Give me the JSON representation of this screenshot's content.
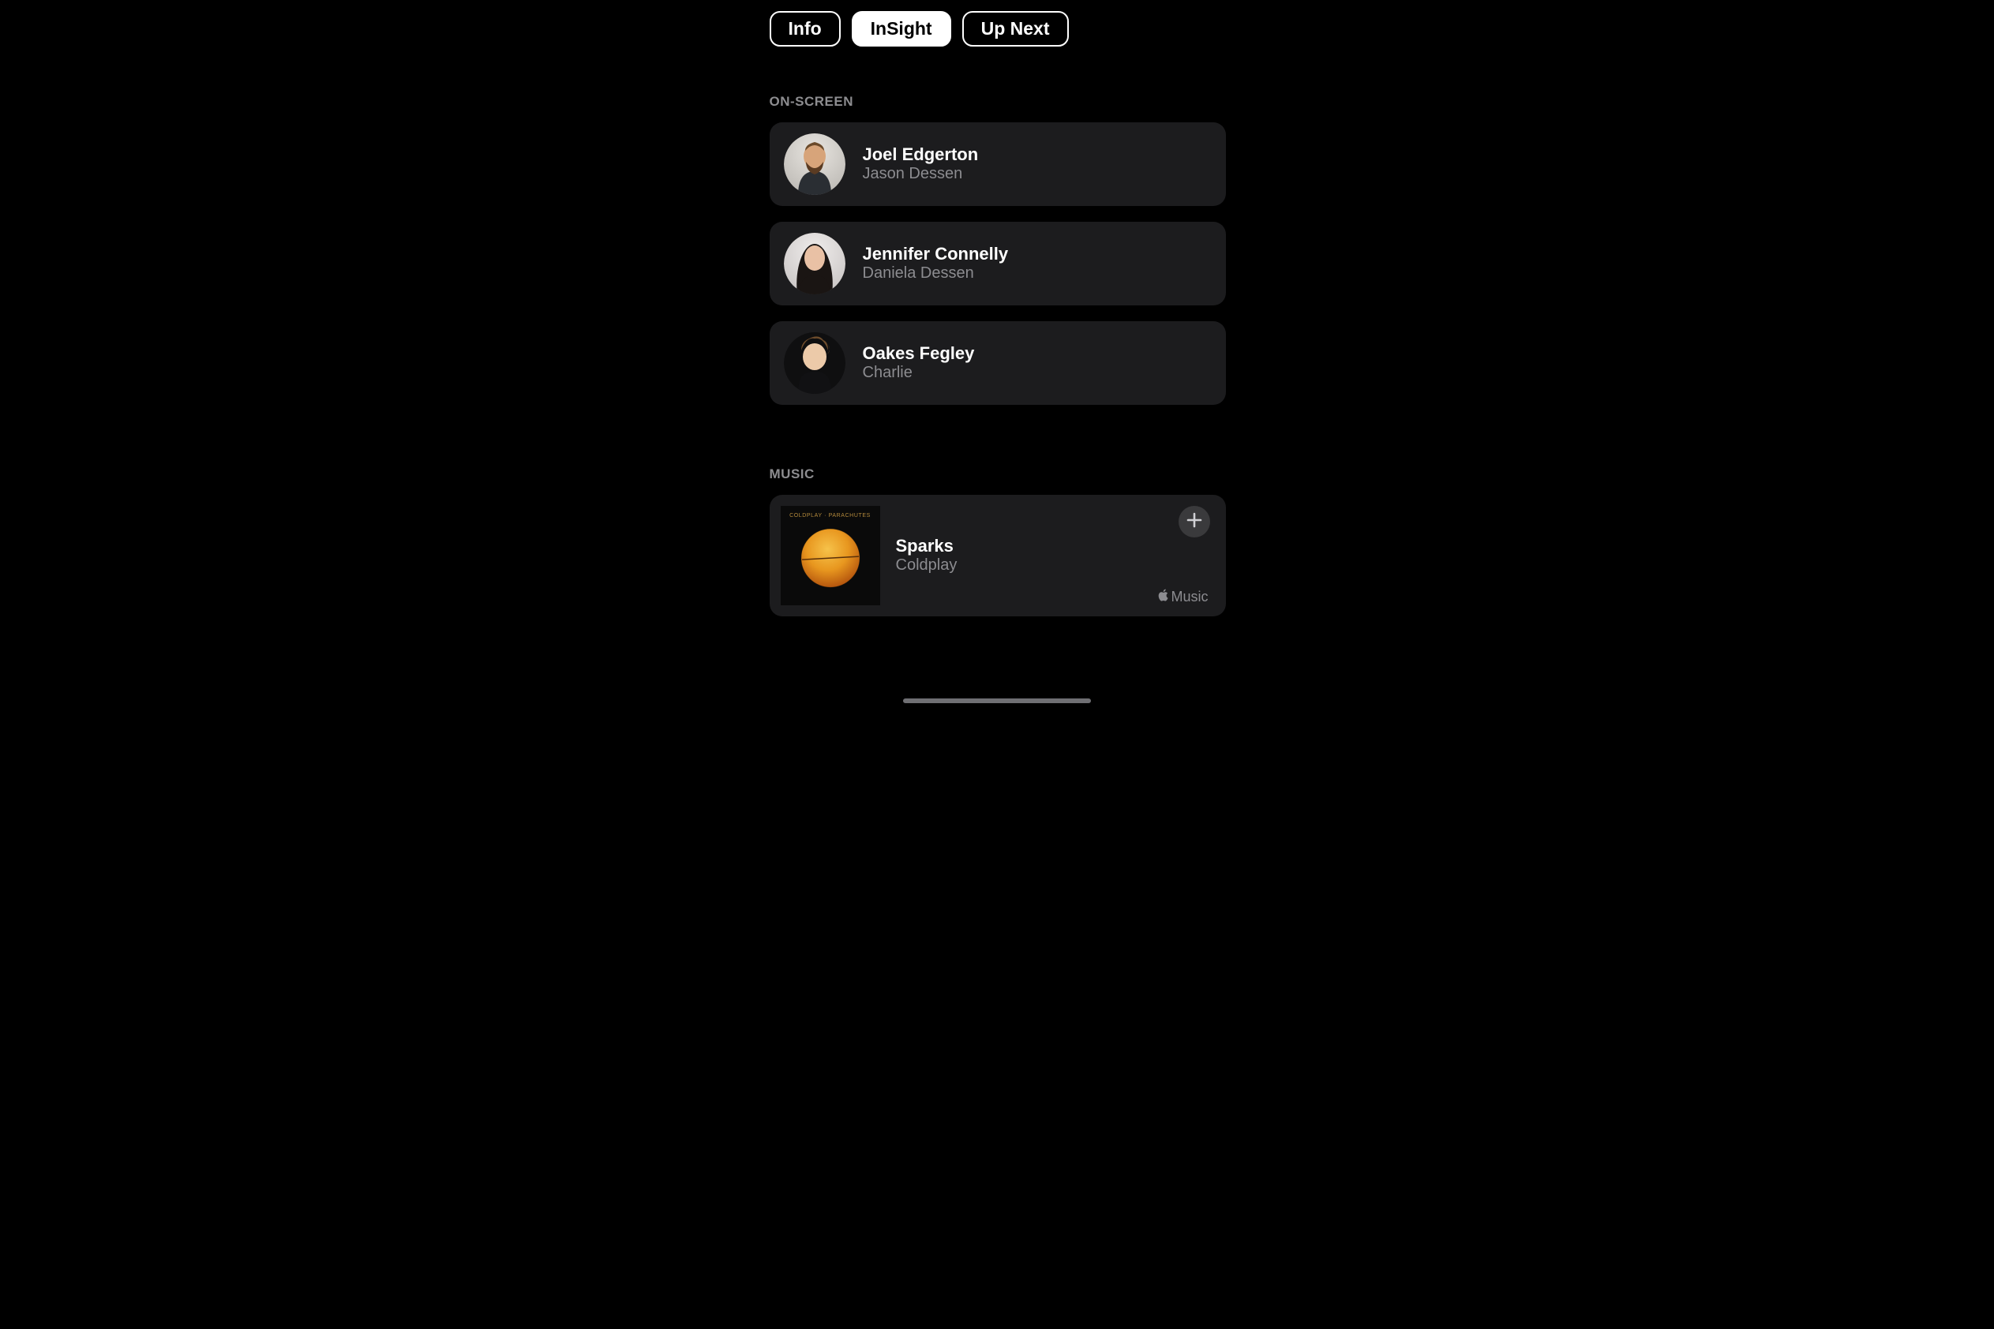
{
  "tabs": [
    {
      "label": "Info",
      "active": false
    },
    {
      "label": "InSight",
      "active": true
    },
    {
      "label": "Up Next",
      "active": false
    }
  ],
  "sections": {
    "onscreen": {
      "header": "ON-SCREEN",
      "items": [
        {
          "name": "Joel Edgerton",
          "role": "Jason Dessen",
          "avatar_style": "actor1"
        },
        {
          "name": "Jennifer Connelly",
          "role": "Daniela Dessen",
          "avatar_style": "actor2"
        },
        {
          "name": "Oakes Fegley",
          "role": "Charlie",
          "avatar_style": "actor3"
        }
      ]
    },
    "music": {
      "header": "MUSIC",
      "item": {
        "track": "Sparks",
        "artist": "Coldplay",
        "album_label": "COLDPLAY · PARACHUTES",
        "service": "Music"
      }
    }
  }
}
